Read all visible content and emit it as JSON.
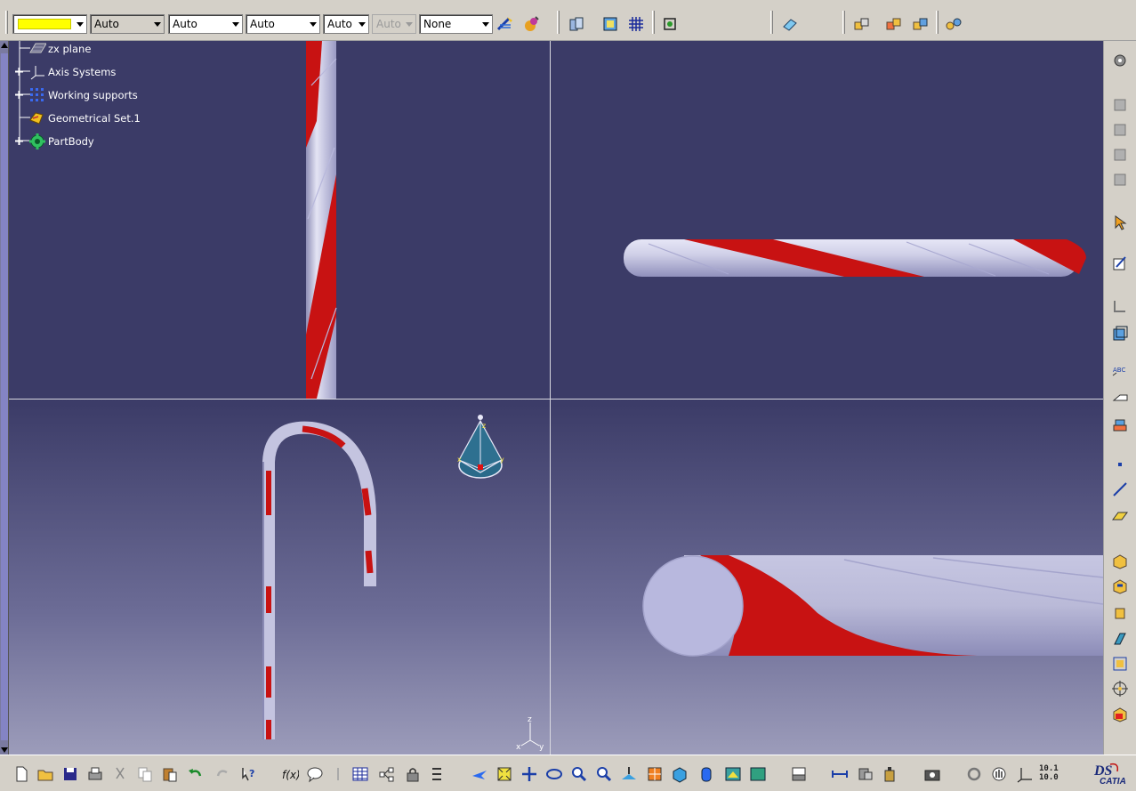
{
  "toolbar_top": {
    "color_swatch": "#ffff00",
    "combos": [
      {
        "label": "Auto",
        "state": "selected"
      },
      {
        "label": "Auto",
        "state": "normal"
      },
      {
        "label": "Auto",
        "state": "normal"
      },
      {
        "label": "Auto",
        "state": "normal"
      },
      {
        "label": "Auto",
        "state": "disabled"
      },
      {
        "label": "None",
        "state": "normal"
      }
    ],
    "icons": [
      "painter-icon",
      "material-icon",
      "scene-icon",
      "view-mode-icon",
      "grid-icon",
      "snap-icon",
      "eraser-icon",
      "assembly-icon",
      "assembly2-icon",
      "assembly3-icon",
      "constraints-icon"
    ]
  },
  "tree": {
    "items": [
      {
        "label": "zx plane",
        "icon": "plane-icon",
        "expandable": false
      },
      {
        "label": "Axis Systems",
        "icon": "axis-icon",
        "expandable": true
      },
      {
        "label": "Working supports",
        "icon": "grid-support-icon",
        "expandable": true
      },
      {
        "label": "Geometrical Set.1",
        "icon": "geoset-icon",
        "expandable": false
      },
      {
        "label": "PartBody",
        "icon": "gear-body-icon",
        "expandable": true
      }
    ]
  },
  "compass": {
    "z_label": "z",
    "y_label": "y",
    "x_label": "x"
  },
  "axis_triad": {
    "x": "x",
    "y": "y",
    "z": "z"
  },
  "colors": {
    "background": "#3b3b67",
    "stripe_red": "#cc1111",
    "stripe_white": "#c8c8e4",
    "splitter": "#d8d8e0"
  },
  "toolbar_bottom": {
    "icons": [
      "new-icon",
      "open-icon",
      "save-icon",
      "print-icon",
      "cut-icon",
      "copy-icon",
      "paste-icon",
      "undo-icon",
      "redo-icon",
      "whats-this-icon",
      "formula-icon",
      "comment-icon",
      "knowledge-icon",
      "table-icon",
      "relations-icon",
      "lock-icon",
      "parameters-icon",
      "fly-icon",
      "fit-all-icon",
      "pan-icon",
      "rotate-icon",
      "zoom-in-icon",
      "zoom-out-icon",
      "normal-view-icon",
      "multiview-icon",
      "iso-view-icon",
      "shading-icon",
      "render-icon",
      "texture-icon",
      "hide-show-icon",
      "measure-icon",
      "capture-icon",
      "mass-icon",
      "camera-icon",
      "refresh-icon",
      "hand-icon",
      "axis-snap-icon"
    ],
    "scale_top": "10.1",
    "scale_bottom": "10.0",
    "brand": "CATIA"
  },
  "toolbar_right": {
    "icons": [
      "settings-icon",
      "view1-icon",
      "view2-icon",
      "view3-icon",
      "view4-icon",
      "select-icon",
      "sketch-icon",
      "constraint-icon",
      "frame-icon",
      "text-abc-icon",
      "annotation-icon",
      "stack-icon",
      "point-icon",
      "line-icon",
      "plane-icon",
      "pad-icon",
      "pocket-icon",
      "shaft-icon",
      "rib-icon",
      "pattern-icon",
      "target-icon",
      "box-icon"
    ]
  }
}
